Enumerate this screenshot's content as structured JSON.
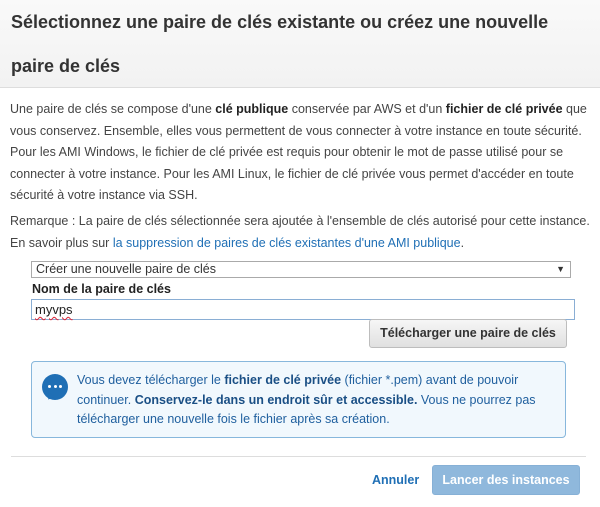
{
  "header": {
    "title": "Sélectionnez une paire de clés existante ou créez une nouvelle paire de clés"
  },
  "description": {
    "p1": "Une paire de clés se compose d'une ",
    "b1": "clé publique",
    "p2": " conservée par AWS et d'un ",
    "b2": "fichier de clé privée",
    "p3": " que vous conservez. Ensemble, elles vous permettent de vous connecter à votre instance en toute sécurité. Pour les AMI Windows, le fichier de clé privée est requis pour obtenir le mot de passe utilisé pour se connecter à votre instance. Pour les AMI Linux, le fichier de clé privée vous permet d'accéder en toute sécurité à votre instance via SSH."
  },
  "remark": {
    "text": "Remarque : La paire de clés sélectionnée sera ajoutée à l'ensemble de clés autorisé pour cette instance. En savoir plus sur ",
    "link": "la suppression de paires de clés existantes d'une AMI publique",
    "end": "."
  },
  "keypair_select": {
    "value": "Créer une nouvelle paire de clés",
    "arrow": "▼"
  },
  "keypair_name": {
    "label": "Nom de la paire de clés",
    "value": "myvps"
  },
  "download_button": "Télécharger une paire de clés",
  "info": {
    "t1": "Vous devez télécharger le ",
    "b1": "fichier de clé privée",
    "t2": " (fichier *.pem) avant de pouvoir continuer. ",
    "b2": "Conservez-le dans un endroit sûr et accessible.",
    "t3": " Vous ne pourrez pas télécharger une nouvelle fois le fichier après sa création."
  },
  "footer": {
    "cancel_label": "Annuler",
    "launch_label": "Lancer des instances"
  },
  "colors": {
    "link": "#1f6fb5",
    "launch_disabled": "#8fb8dc",
    "info_bg": "#f1f8fd",
    "info_border": "#87b7dc"
  }
}
